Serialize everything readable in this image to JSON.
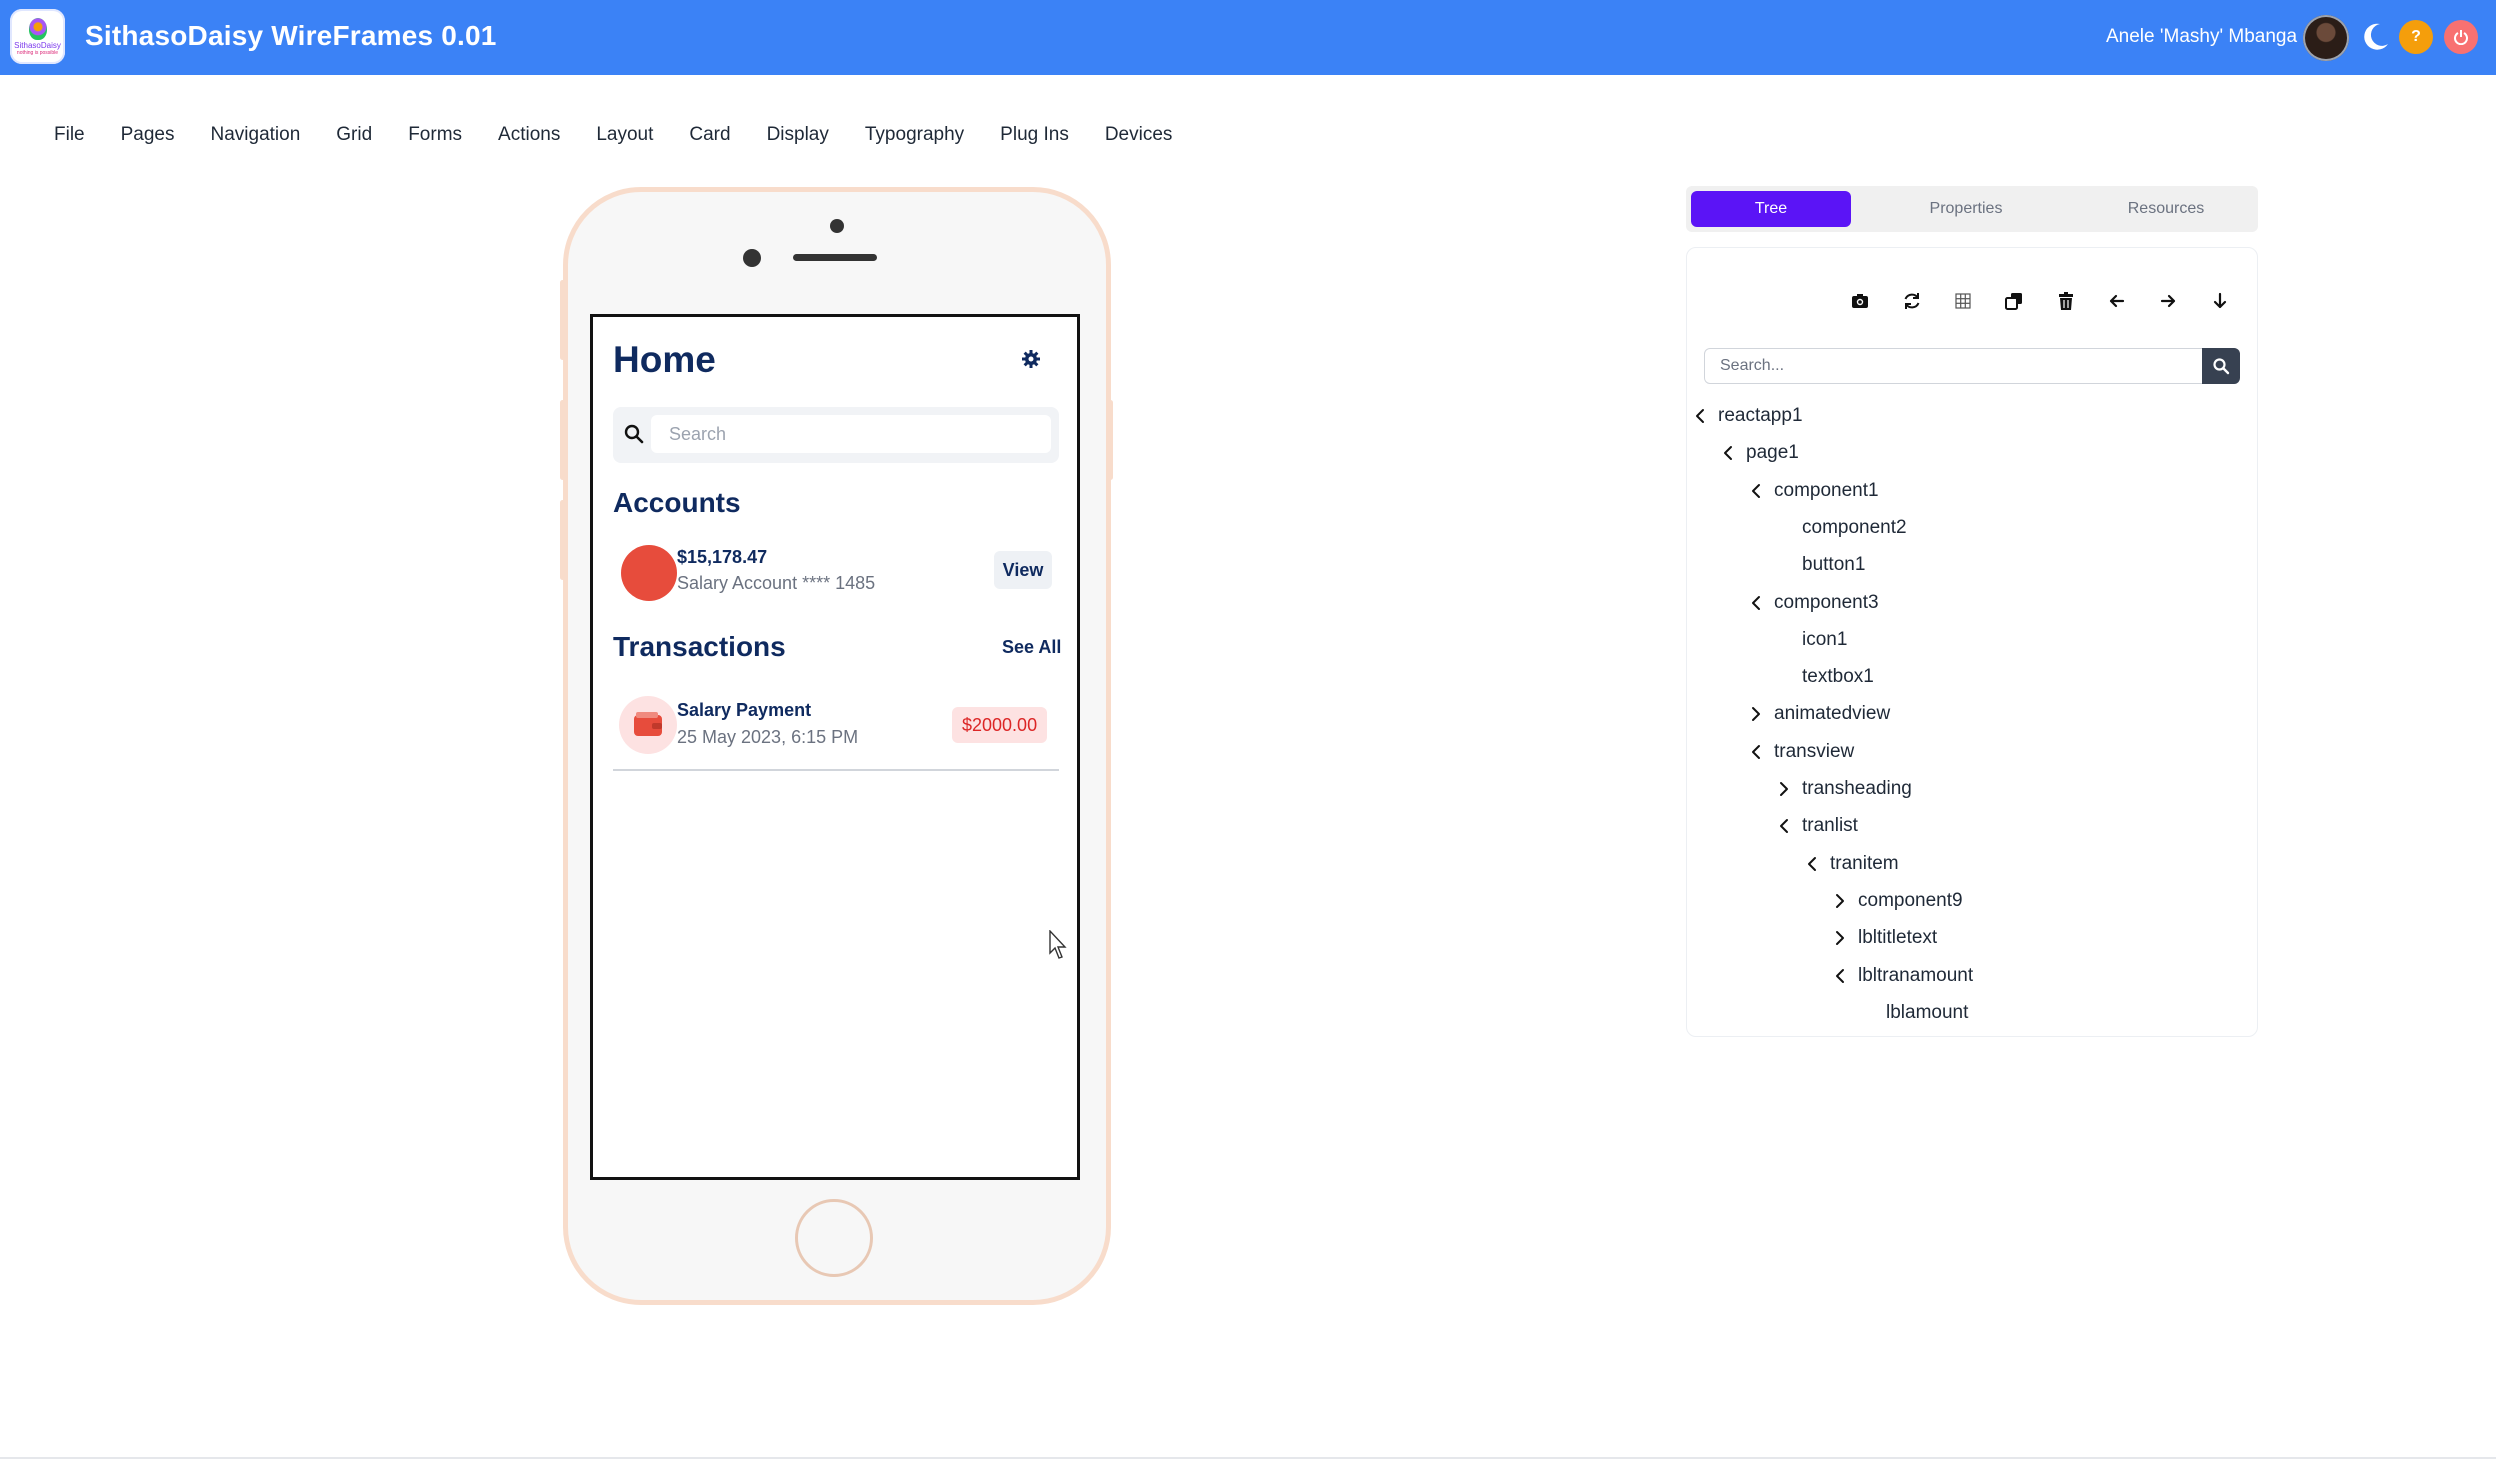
{
  "app": {
    "title": "SithasoDaisy WireFrames 0.01",
    "logo_text_line1": "SithasoDaisy",
    "logo_text_line2": "nothing is possible",
    "user_name": "Anele 'Mashy' Mbanga"
  },
  "colors": {
    "appbar": "#3b82f6",
    "active_tab": "#5b14f6",
    "primary_text": "#0f2a5f",
    "accent_red": "#e74c3c",
    "help_button": "#f59e0b",
    "power_button": "#f87171"
  },
  "menu": [
    "File",
    "Pages",
    "Navigation",
    "Grid",
    "Forms",
    "Actions",
    "Layout",
    "Card",
    "Display",
    "Typography",
    "Plug Ins",
    "Devices"
  ],
  "phone": {
    "screen_title": "Home",
    "search_placeholder": "Search",
    "accounts_title": "Accounts",
    "account": {
      "amount": "$15,178.47",
      "subtitle": "Salary Account **** 1485",
      "view_label": "View"
    },
    "transactions_title": "Transactions",
    "see_all_label": "See All",
    "transaction": {
      "title": "Salary Payment",
      "date": "25 May 2023, 6:15 PM",
      "amount": "$2000.00"
    }
  },
  "panel": {
    "tabs": [
      "Tree",
      "Properties",
      "Resources"
    ],
    "active_tab": "Tree",
    "toolbar_icons": [
      "camera-icon",
      "refresh-icon",
      "grid-icon",
      "copy-icon",
      "trash-icon",
      "arrow-left-icon",
      "arrow-right-icon",
      "arrow-down-icon"
    ],
    "search_placeholder": "Search...",
    "tree": [
      {
        "label": "reactapp1",
        "level": 0,
        "state": "expanded"
      },
      {
        "label": "page1",
        "level": 1,
        "state": "expanded"
      },
      {
        "label": "component1",
        "level": 2,
        "state": "expanded"
      },
      {
        "label": "component2",
        "level": 3,
        "state": "leaf"
      },
      {
        "label": "button1",
        "level": 3,
        "state": "leaf"
      },
      {
        "label": "component3",
        "level": 2,
        "state": "expanded"
      },
      {
        "label": "icon1",
        "level": 3,
        "state": "leaf"
      },
      {
        "label": "textbox1",
        "level": 3,
        "state": "leaf"
      },
      {
        "label": "animatedview",
        "level": 2,
        "state": "collapsed"
      },
      {
        "label": "transview",
        "level": 2,
        "state": "expanded"
      },
      {
        "label": "transheading",
        "level": 3,
        "state": "collapsed"
      },
      {
        "label": "tranlist",
        "level": 3,
        "state": "expanded"
      },
      {
        "label": "tranitem",
        "level": 4,
        "state": "expanded"
      },
      {
        "label": "component9",
        "level": 5,
        "state": "collapsed"
      },
      {
        "label": "lbltitletext",
        "level": 5,
        "state": "collapsed"
      },
      {
        "label": "lbltranamount",
        "level": 5,
        "state": "expanded"
      },
      {
        "label": "lblamount",
        "level": 6,
        "state": "leaf"
      }
    ]
  }
}
